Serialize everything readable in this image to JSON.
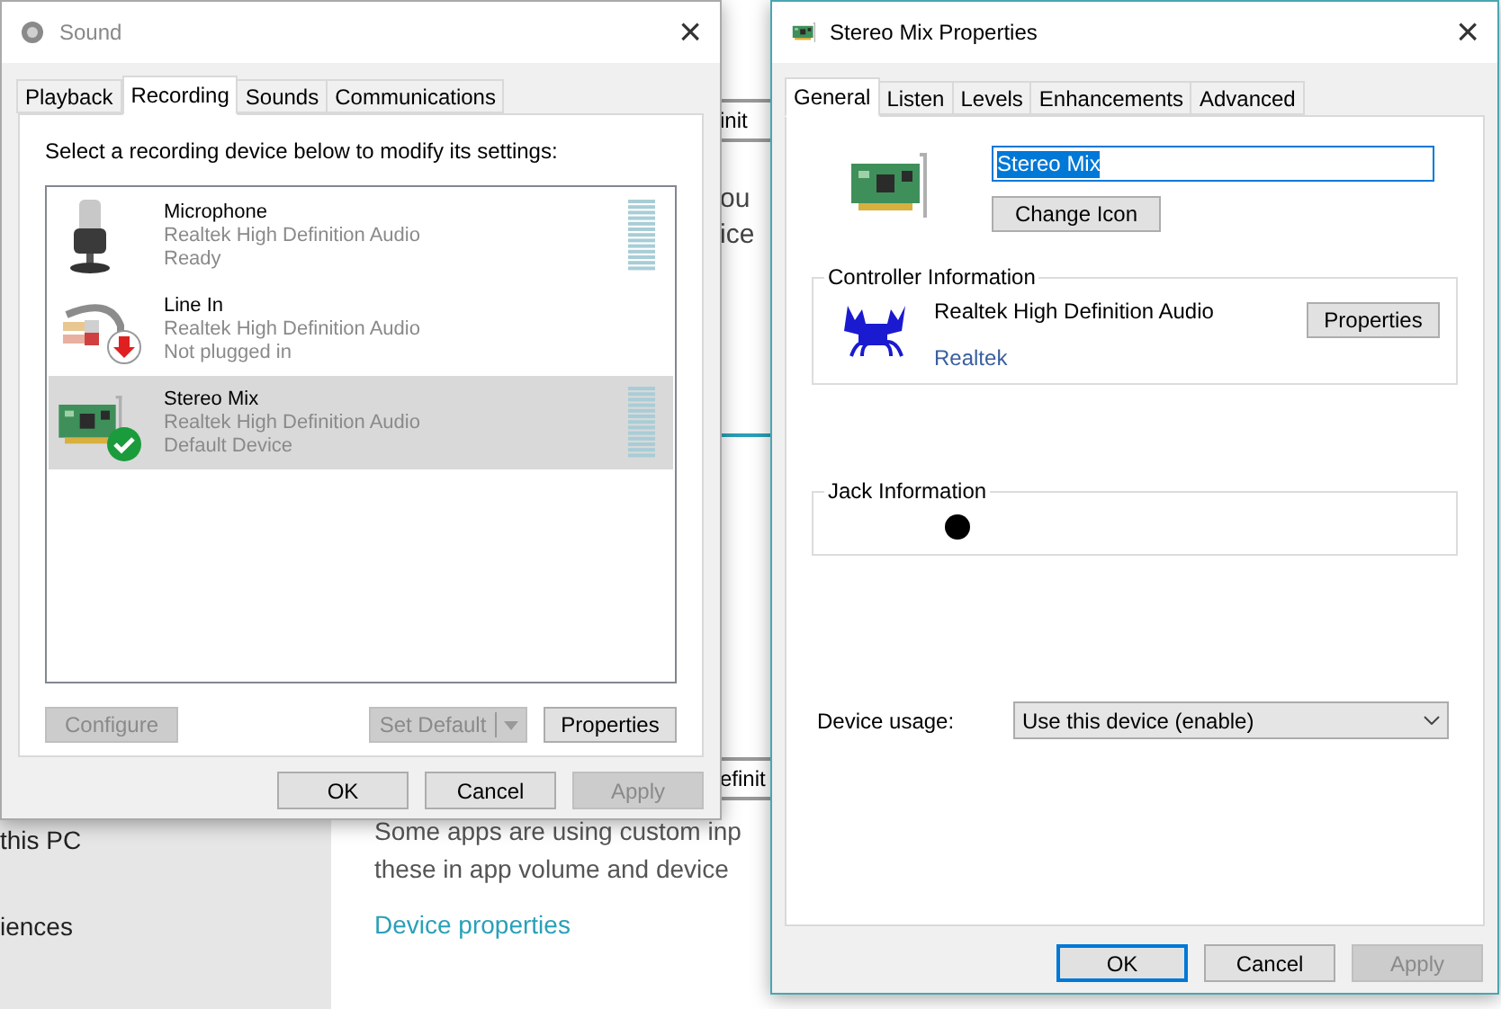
{
  "background": {
    "sidebar_items": [
      "this PC",
      "iences"
    ],
    "fragments": [
      {
        "kind": "box",
        "text": "init"
      },
      {
        "kind": "text",
        "text": "ou"
      },
      {
        "kind": "text",
        "text": "ice"
      },
      {
        "kind": "rule"
      },
      {
        "kind": "box",
        "text": "efinit"
      }
    ],
    "description_lines": [
      "Some apps are using custom inp",
      "these in app volume and device"
    ],
    "link": "Device properties"
  },
  "sound_dialog": {
    "title": "Sound",
    "close": "×",
    "tabs": [
      {
        "label": "Playback",
        "selected": false
      },
      {
        "label": "Recording",
        "selected": true
      },
      {
        "label": "Sounds",
        "selected": false
      },
      {
        "label": "Communications",
        "selected": false
      }
    ],
    "instruction": "Select a recording device below to modify its settings:",
    "devices": [
      {
        "kind": "microphone",
        "name": "Microphone",
        "driver": "Realtek High Definition Audio",
        "status": "Ready",
        "unplugged": false,
        "default": false,
        "meter": true,
        "selected": false
      },
      {
        "kind": "line-in",
        "name": "Line In",
        "driver": "Realtek High Definition Audio",
        "status": "Not plugged in",
        "unplugged": true,
        "default": false,
        "meter": false,
        "selected": false
      },
      {
        "kind": "card",
        "name": "Stereo Mix",
        "driver": "Realtek High Definition Audio",
        "status": "Default Device",
        "unplugged": false,
        "default": true,
        "meter": true,
        "selected": true
      }
    ],
    "configure": {
      "label": "Configure",
      "disabled": true
    },
    "set_default": {
      "label": "Set Default",
      "disabled": true
    },
    "properties": {
      "label": "Properties",
      "disabled": false
    },
    "buttons": [
      {
        "label": "OK",
        "disabled": false
      },
      {
        "label": "Cancel",
        "disabled": false
      },
      {
        "label": "Apply",
        "disabled": true
      }
    ]
  },
  "properties_dialog": {
    "title": "Stereo Mix Properties",
    "close": "×",
    "tabs": [
      {
        "label": "General",
        "selected": true
      },
      {
        "label": "Listen",
        "selected": false
      },
      {
        "label": "Levels",
        "selected": false
      },
      {
        "label": "Enhancements",
        "selected": false
      },
      {
        "label": "Advanced",
        "selected": false
      }
    ],
    "name_value": "Stereo Mix",
    "change_icon": "Change Icon",
    "controller": {
      "heading": "Controller Information",
      "name": "Realtek High Definition Audio",
      "vendor": "Realtek",
      "properties": "Properties"
    },
    "jack": {
      "heading": "Jack Information"
    },
    "usage": {
      "label": "Device usage:",
      "value": "Use this device (enable)"
    },
    "buttons": [
      {
        "label": "OK",
        "disabled": false,
        "focused": true
      },
      {
        "label": "Cancel",
        "disabled": false,
        "focused": false
      },
      {
        "label": "Apply",
        "disabled": true,
        "focused": false
      }
    ]
  }
}
